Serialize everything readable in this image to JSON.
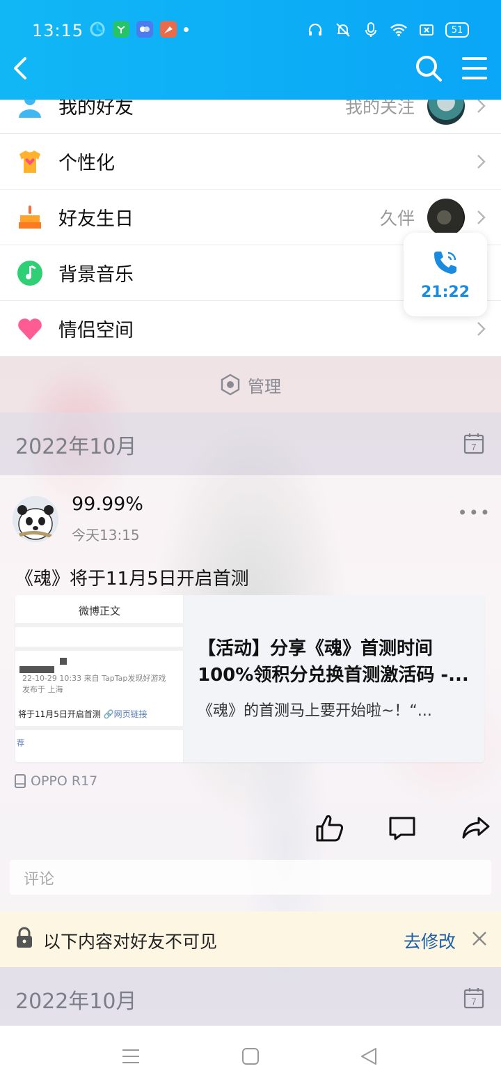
{
  "status_bar": {
    "time": "13:15",
    "battery": "51",
    "app_icons": [
      "qq-browser-icon",
      "green-app-icon",
      "blue-app-icon",
      "purple-app-icon"
    ]
  },
  "header": {
    "back_icon": "chevron-left-icon",
    "search_icon": "search-icon",
    "menu_icon": "hamburger-menu-icon"
  },
  "menu_rows": [
    {
      "label": "我的好友",
      "right_text": "我的关注",
      "icon": "friend-icon"
    },
    {
      "label": "个性化",
      "right_text": "",
      "icon": "tshirt-icon"
    },
    {
      "label": "好友生日",
      "right_text": "久伴",
      "icon": "birthday-cake-icon"
    },
    {
      "label": "背景音乐",
      "right_text": "",
      "icon": "music-note-icon"
    },
    {
      "label": "情侣空间",
      "right_text": "",
      "icon": "heart-icon"
    }
  ],
  "call_widget": {
    "time": "21:22",
    "icon": "phone-icon"
  },
  "manage": {
    "label": "管理"
  },
  "month_sections": [
    {
      "label": "2022年10月"
    },
    {
      "label": "2022年10月"
    }
  ],
  "post": {
    "author": "99.99%",
    "time": "今天13:15",
    "more": "•••",
    "text": "《魂》将于11月5日开启首测",
    "card": {
      "thumb_title": "微博正文",
      "thumb_meta_line1": "22-10-29 10:33  来自 TapTap发现好游戏",
      "thumb_meta_line2": "发布于 上海",
      "thumb_body": "将于11月5日开启首测",
      "thumb_link": "🔗网页链接",
      "thumb_tag": "荐",
      "title": "【活动】分享《魂》首测时间100%领积分兑换首测激活码 -...",
      "desc": "《魂》的首测马上要开始啦~！“..."
    },
    "device": "OPPO R17",
    "comment_placeholder": "评论"
  },
  "notice": {
    "text": "以下内容对好友不可见",
    "action": "去修改"
  },
  "colors": {
    "header_bg": "#0aa6f7",
    "link_blue": "#1d5fa8",
    "call_blue": "#1b8be0",
    "notice_bg": "#fdf6e3"
  }
}
